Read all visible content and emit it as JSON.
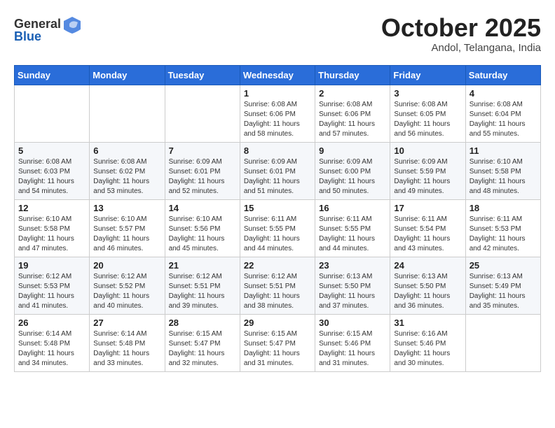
{
  "header": {
    "logo_general": "General",
    "logo_blue": "Blue",
    "month": "October 2025",
    "location": "Andol, Telangana, India"
  },
  "days_of_week": [
    "Sunday",
    "Monday",
    "Tuesday",
    "Wednesday",
    "Thursday",
    "Friday",
    "Saturday"
  ],
  "weeks": [
    [
      {
        "day": "",
        "info": ""
      },
      {
        "day": "",
        "info": ""
      },
      {
        "day": "",
        "info": ""
      },
      {
        "day": "1",
        "info": "Sunrise: 6:08 AM\nSunset: 6:06 PM\nDaylight: 11 hours\nand 58 minutes."
      },
      {
        "day": "2",
        "info": "Sunrise: 6:08 AM\nSunset: 6:06 PM\nDaylight: 11 hours\nand 57 minutes."
      },
      {
        "day": "3",
        "info": "Sunrise: 6:08 AM\nSunset: 6:05 PM\nDaylight: 11 hours\nand 56 minutes."
      },
      {
        "day": "4",
        "info": "Sunrise: 6:08 AM\nSunset: 6:04 PM\nDaylight: 11 hours\nand 55 minutes."
      }
    ],
    [
      {
        "day": "5",
        "info": "Sunrise: 6:08 AM\nSunset: 6:03 PM\nDaylight: 11 hours\nand 54 minutes."
      },
      {
        "day": "6",
        "info": "Sunrise: 6:08 AM\nSunset: 6:02 PM\nDaylight: 11 hours\nand 53 minutes."
      },
      {
        "day": "7",
        "info": "Sunrise: 6:09 AM\nSunset: 6:01 PM\nDaylight: 11 hours\nand 52 minutes."
      },
      {
        "day": "8",
        "info": "Sunrise: 6:09 AM\nSunset: 6:01 PM\nDaylight: 11 hours\nand 51 minutes."
      },
      {
        "day": "9",
        "info": "Sunrise: 6:09 AM\nSunset: 6:00 PM\nDaylight: 11 hours\nand 50 minutes."
      },
      {
        "day": "10",
        "info": "Sunrise: 6:09 AM\nSunset: 5:59 PM\nDaylight: 11 hours\nand 49 minutes."
      },
      {
        "day": "11",
        "info": "Sunrise: 6:10 AM\nSunset: 5:58 PM\nDaylight: 11 hours\nand 48 minutes."
      }
    ],
    [
      {
        "day": "12",
        "info": "Sunrise: 6:10 AM\nSunset: 5:58 PM\nDaylight: 11 hours\nand 47 minutes."
      },
      {
        "day": "13",
        "info": "Sunrise: 6:10 AM\nSunset: 5:57 PM\nDaylight: 11 hours\nand 46 minutes."
      },
      {
        "day": "14",
        "info": "Sunrise: 6:10 AM\nSunset: 5:56 PM\nDaylight: 11 hours\nand 45 minutes."
      },
      {
        "day": "15",
        "info": "Sunrise: 6:11 AM\nSunset: 5:55 PM\nDaylight: 11 hours\nand 44 minutes."
      },
      {
        "day": "16",
        "info": "Sunrise: 6:11 AM\nSunset: 5:55 PM\nDaylight: 11 hours\nand 44 minutes."
      },
      {
        "day": "17",
        "info": "Sunrise: 6:11 AM\nSunset: 5:54 PM\nDaylight: 11 hours\nand 43 minutes."
      },
      {
        "day": "18",
        "info": "Sunrise: 6:11 AM\nSunset: 5:53 PM\nDaylight: 11 hours\nand 42 minutes."
      }
    ],
    [
      {
        "day": "19",
        "info": "Sunrise: 6:12 AM\nSunset: 5:53 PM\nDaylight: 11 hours\nand 41 minutes."
      },
      {
        "day": "20",
        "info": "Sunrise: 6:12 AM\nSunset: 5:52 PM\nDaylight: 11 hours\nand 40 minutes."
      },
      {
        "day": "21",
        "info": "Sunrise: 6:12 AM\nSunset: 5:51 PM\nDaylight: 11 hours\nand 39 minutes."
      },
      {
        "day": "22",
        "info": "Sunrise: 6:12 AM\nSunset: 5:51 PM\nDaylight: 11 hours\nand 38 minutes."
      },
      {
        "day": "23",
        "info": "Sunrise: 6:13 AM\nSunset: 5:50 PM\nDaylight: 11 hours\nand 37 minutes."
      },
      {
        "day": "24",
        "info": "Sunrise: 6:13 AM\nSunset: 5:50 PM\nDaylight: 11 hours\nand 36 minutes."
      },
      {
        "day": "25",
        "info": "Sunrise: 6:13 AM\nSunset: 5:49 PM\nDaylight: 11 hours\nand 35 minutes."
      }
    ],
    [
      {
        "day": "26",
        "info": "Sunrise: 6:14 AM\nSunset: 5:48 PM\nDaylight: 11 hours\nand 34 minutes."
      },
      {
        "day": "27",
        "info": "Sunrise: 6:14 AM\nSunset: 5:48 PM\nDaylight: 11 hours\nand 33 minutes."
      },
      {
        "day": "28",
        "info": "Sunrise: 6:15 AM\nSunset: 5:47 PM\nDaylight: 11 hours\nand 32 minutes."
      },
      {
        "day": "29",
        "info": "Sunrise: 6:15 AM\nSunset: 5:47 PM\nDaylight: 11 hours\nand 31 minutes."
      },
      {
        "day": "30",
        "info": "Sunrise: 6:15 AM\nSunset: 5:46 PM\nDaylight: 11 hours\nand 31 minutes."
      },
      {
        "day": "31",
        "info": "Sunrise: 6:16 AM\nSunset: 5:46 PM\nDaylight: 11 hours\nand 30 minutes."
      },
      {
        "day": "",
        "info": ""
      }
    ]
  ]
}
